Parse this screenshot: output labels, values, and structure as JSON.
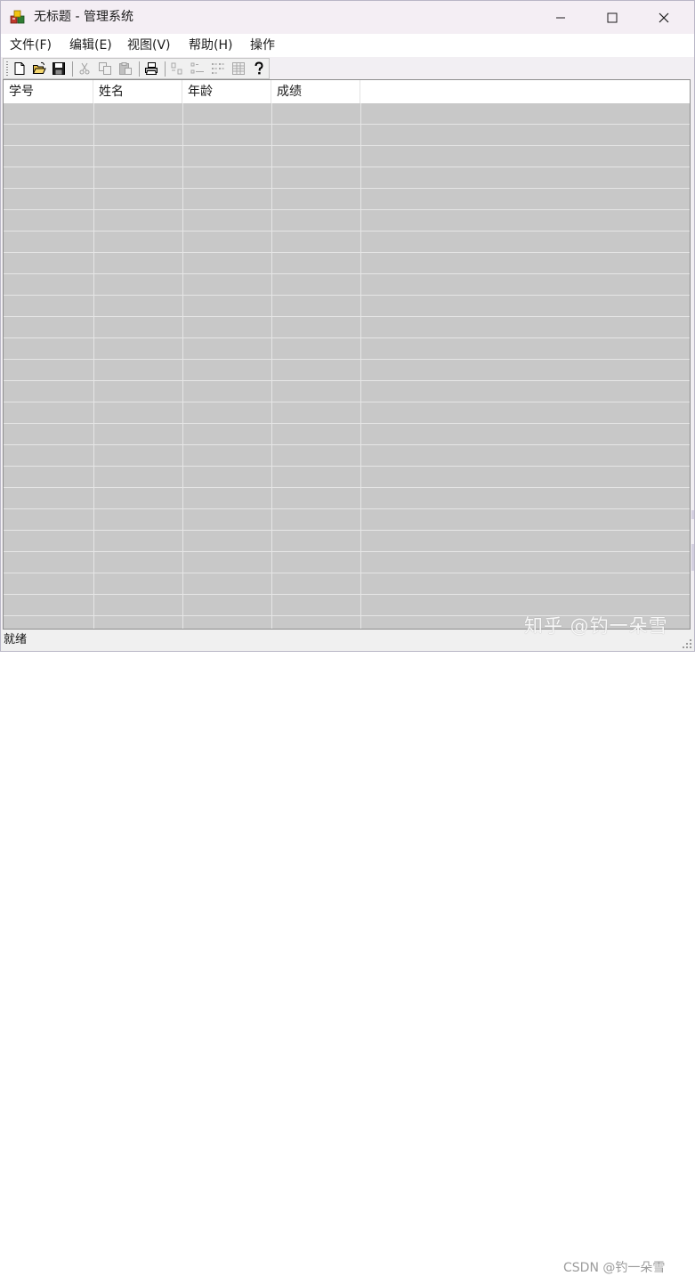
{
  "window": {
    "title": "无标题 - 管理系统"
  },
  "menu": {
    "items": [
      {
        "label": "文件(F)"
      },
      {
        "label": "编辑(E)"
      },
      {
        "label": "视图(V)"
      },
      {
        "label": "帮助(H)"
      },
      {
        "label": "操作"
      }
    ]
  },
  "toolbar": {
    "buttons": [
      {
        "icon": "new-document-icon",
        "enabled": true
      },
      {
        "icon": "open-folder-icon",
        "enabled": true
      },
      {
        "icon": "save-icon",
        "enabled": true
      },
      {
        "icon": "cut-icon",
        "enabled": false
      },
      {
        "icon": "copy-icon",
        "enabled": false
      },
      {
        "icon": "paste-icon",
        "enabled": false
      },
      {
        "icon": "print-icon",
        "enabled": true
      },
      {
        "icon": "large-icons-view-icon",
        "enabled": false
      },
      {
        "icon": "small-icons-view-icon",
        "enabled": false
      },
      {
        "icon": "list-view-icon",
        "enabled": false
      },
      {
        "icon": "details-view-icon",
        "enabled": false
      },
      {
        "icon": "help-icon",
        "enabled": true
      }
    ]
  },
  "table": {
    "columns": [
      "学号",
      "姓名",
      "年龄",
      "成绩"
    ],
    "rows": []
  },
  "status": {
    "text": "就绪"
  },
  "watermark": {
    "line1": "知乎 @钓一朵雪",
    "line2": "CSDN @钓一朵雪"
  },
  "colors": {
    "list_background": "#c8c8c8",
    "title_bar": "#f4eef4"
  }
}
